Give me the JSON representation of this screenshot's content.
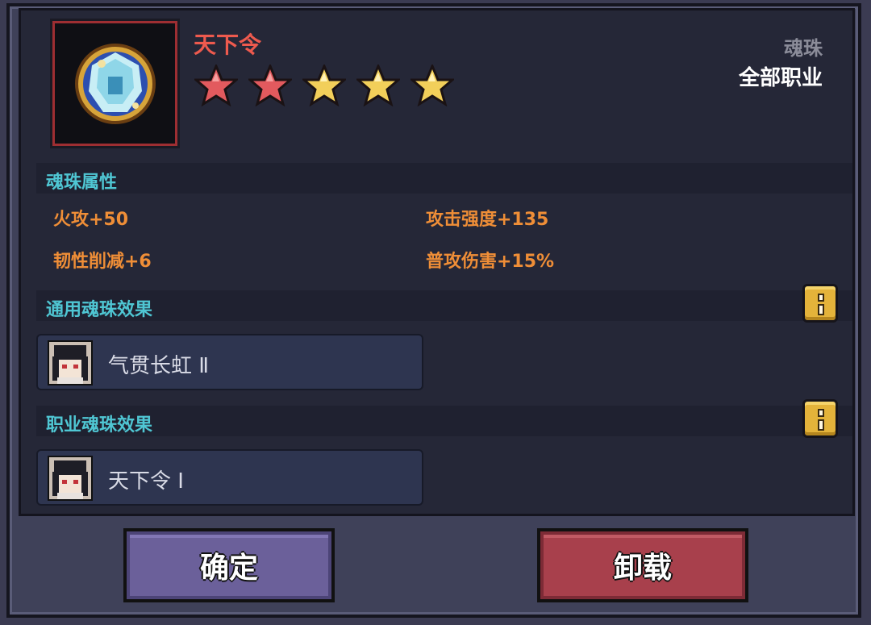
{
  "item": {
    "name": "天下令",
    "type": "魂珠",
    "class": "全部职业",
    "stars": {
      "total": 5,
      "red": 2,
      "gold": 3
    },
    "icon": "soul-orb-icon"
  },
  "attributes": {
    "title": "魂珠属性",
    "list": [
      "火攻+50",
      "攻击强度+135",
      "韧性削减+6",
      "普攻伤害+15%"
    ]
  },
  "common_effect": {
    "title": "通用魂珠效果",
    "skill_label": "气贯长虹 Ⅱ"
  },
  "class_effect": {
    "title": "职业魂珠效果",
    "skill_label": "天下令 Ⅰ"
  },
  "buttons": {
    "confirm": "确定",
    "unload": "卸载"
  },
  "colors": {
    "name": "#ee5a4e",
    "section_title": "#4fc6d3",
    "attribute": "#ef8e37",
    "confirm_button": "#6b609a",
    "unload_button": "#a8404c",
    "star_red": "#e25a5e",
    "star_gold": "#f2cf5a"
  }
}
